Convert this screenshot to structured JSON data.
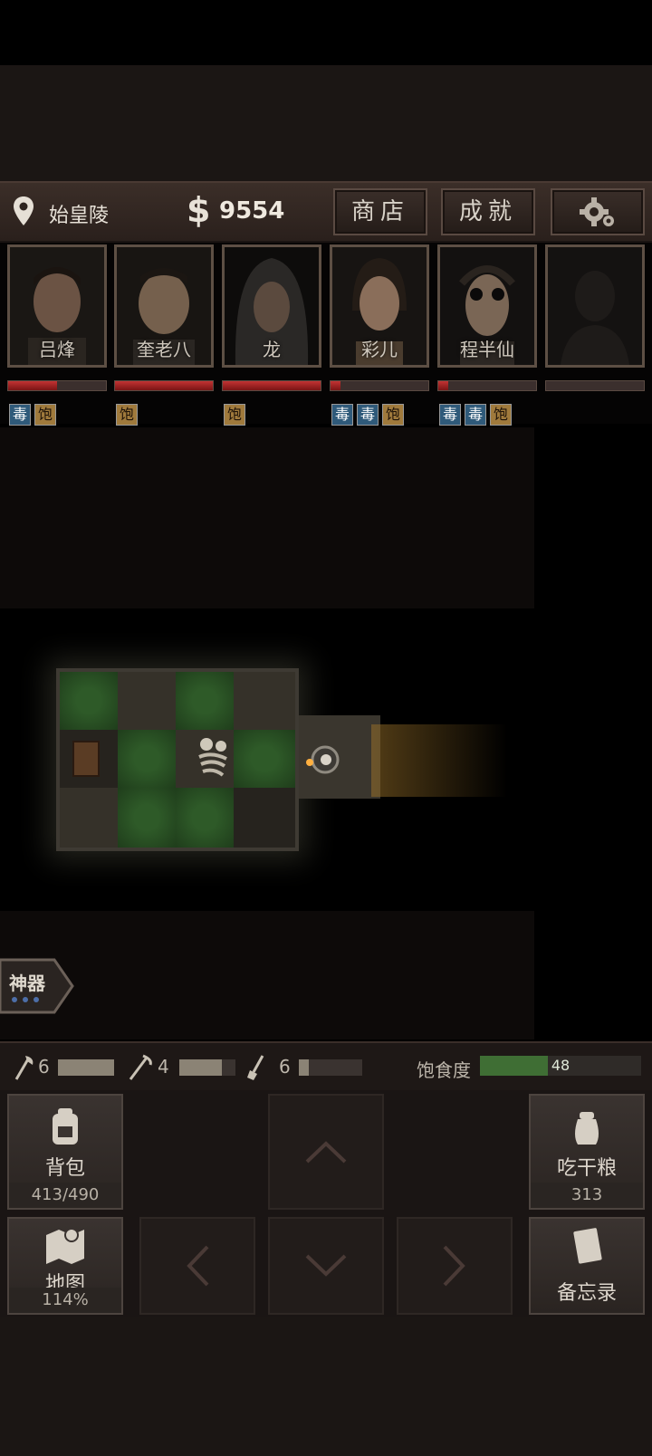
{
  "topbar": {
    "location": "始皇陵",
    "money_symbol": "$",
    "money": "9554",
    "shop_label": "商店",
    "achievements_label": "成就",
    "settings_icon": "gear-icon"
  },
  "party": [
    {
      "name": "吕烽",
      "hp": 0.5,
      "tags": [
        "毒",
        "饱"
      ]
    },
    {
      "name": "奎老八",
      "hp": 1.0,
      "tags": [
        "饱"
      ]
    },
    {
      "name": "龙",
      "hp": 1.0,
      "tags": [
        "饱"
      ]
    },
    {
      "name": "彩儿",
      "hp": 0.1,
      "tags": [
        "毒",
        "毒",
        "饱"
      ]
    },
    {
      "name": "程半仙",
      "hp": 0.1,
      "tags": [
        "毒",
        "毒",
        "饱"
      ]
    },
    {
      "name": "",
      "hp": 0,
      "tags": []
    }
  ],
  "artifact": {
    "label": "神器"
  },
  "tools": {
    "axe": {
      "count": "6",
      "level": 1.0
    },
    "pick": {
      "count": "4",
      "level": 0.75
    },
    "shovel": {
      "count": "6",
      "level": 0.15
    }
  },
  "satiety": {
    "label": "饱食度",
    "value": "48",
    "level": 0.42
  },
  "controls": {
    "backpack": {
      "label": "背包",
      "sub": "413/490"
    },
    "eat": {
      "label": "吃干粮",
      "sub": "313"
    },
    "map": {
      "label": "地图",
      "sub": "114%"
    },
    "memo": {
      "label": "备忘录"
    }
  },
  "colors": {
    "hp": "#c23232",
    "poison": "#2f5a7a",
    "full": "#a07a3c",
    "satiety": "#3f6e34"
  }
}
